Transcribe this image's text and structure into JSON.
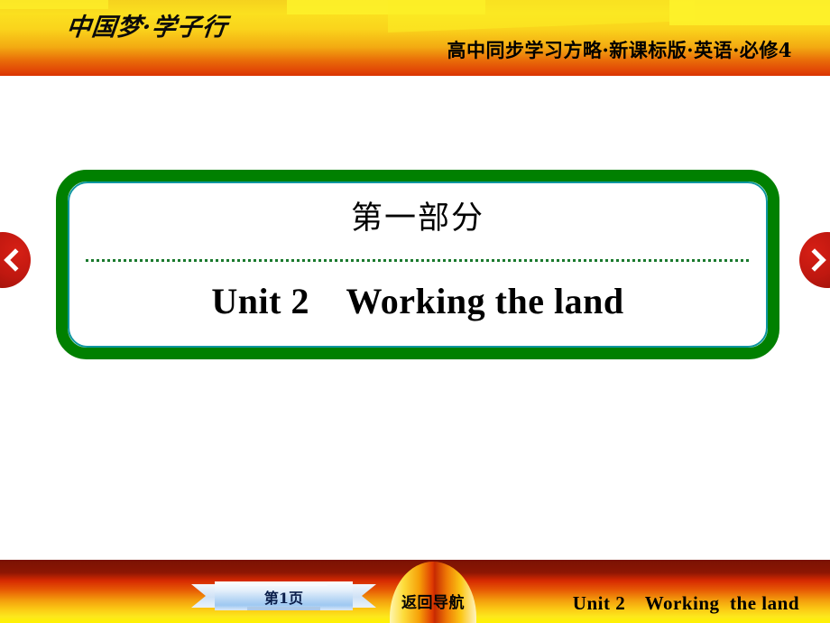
{
  "header": {
    "brand_logo": "中国梦·学子行",
    "book_title": "高中同步学习方略·新课标版·英语·必修4",
    "gradient_top": "#fbe01f",
    "gradient_bottom": "#d93302"
  },
  "navigation": {
    "prev_icon": "chevron-left-icon",
    "next_icon": "chevron-right-icon",
    "button_color": "#c01810"
  },
  "main": {
    "part_label": "第一部分",
    "unit_title": "Unit 2　Working the land",
    "border_color": "#008000",
    "inner_border_color": "#0e96a0",
    "divider_color": "#1a7a2e"
  },
  "footer": {
    "page_label": "第1页",
    "return_nav_label": "返回导航",
    "unit_text": "Unit 2　Working  the land",
    "gradient_top": "#7a1203",
    "gradient_bottom": "#fff200"
  }
}
